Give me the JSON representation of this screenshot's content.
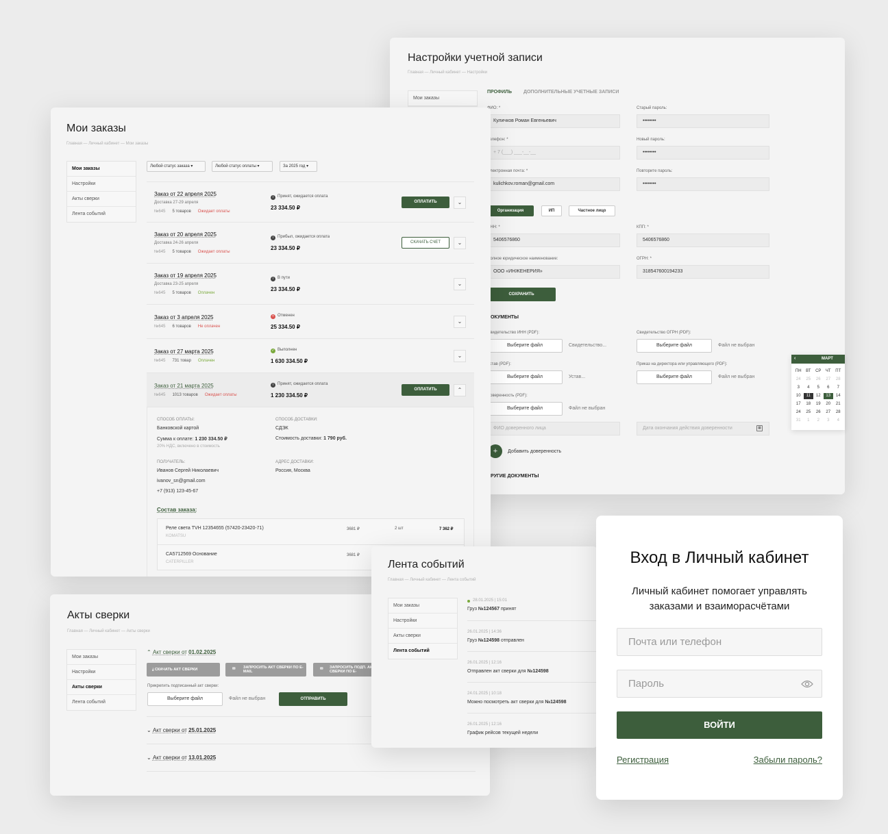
{
  "colors": {
    "accent": "#3d5e3c",
    "danger": "#d9534f",
    "success": "#7aa93c",
    "background": "#ececec"
  },
  "settings": {
    "title": "Настройки учетной записи",
    "breadcrumb": "Главная — Личный кабинет — Настройки",
    "sidebar": [
      "Мои заказы"
    ],
    "tabs": [
      "ПРОФИЛЬ",
      "ДОПОЛНИТЕЛЬНЫЕ УЧЕТНЫЕ ЗАПИСИ"
    ],
    "fio_label": "ФИО: *",
    "fio_value": "Куличков Роман Евгеньевич",
    "phone_label": "Телефон: *",
    "phone_placeholder": "+ 7 (___) ___-__-__",
    "email_label": "Электронная почта: *",
    "email_value": "kulichkov.roman@gmail.com",
    "old_pass_label": "Старый пароль:",
    "new_pass_label": "Новый пароль:",
    "repeat_pass_label": "Повторите пароль:",
    "pass_mask": "••••••••",
    "type_buttons": [
      "Организация",
      "ИП",
      "Частное лицо"
    ],
    "inn_label": "ИНН: *",
    "inn_value": "5406576860",
    "kpp_label": "КПП: *",
    "kpp_value": "5406576860",
    "fullname_label": "Полное юридическое наименование:",
    "fullname_value": "ООО «ИНЖЕНЕРИЯ»",
    "ogrn_label": "ОГРН: *",
    "ogrn_value": "318547600194233",
    "save_label": "СОХРАНИТЬ",
    "docs_heading": "ДОКУМЕНТЫ",
    "doc_inn_label": "Свидетельство ИНН (PDF):",
    "doc_inn_file": "Свидетельство...",
    "doc_ogrn_label": "Свидетельство ОГРН (PDF):",
    "doc_ogrn_file": "Файл не выбран",
    "doc_ustav_label": "Устав (PDF):",
    "doc_ustav_file": "Устав...",
    "doc_prikaz_label": "Приказ на директора или управляющего (PDF):",
    "doc_prikaz_file": "Файл не выбран",
    "doc_dov_label": "Доверенность (PDF):",
    "doc_dov_file": "Файл не выбран",
    "choose_file": "Выберите файл",
    "fio_dov_placeholder": "ФИО доверенного лица",
    "dov_end_placeholder": "Дата окончания действия доверенности",
    "add_dov": "Добавить доверенность",
    "other_docs": "ДРУГИЕ ДОКУМЕНТЫ"
  },
  "calendar": {
    "month": "МАРТ",
    "weekdays": [
      "ПН",
      "ВТ",
      "СР",
      "ЧТ",
      "ПТ"
    ],
    "days": [
      "24",
      "25",
      "26",
      "27",
      "28",
      "3",
      "4",
      "5",
      "6",
      "7",
      "10",
      "11",
      "12",
      "13",
      "14",
      "17",
      "18",
      "19",
      "20",
      "21",
      "24",
      "25",
      "26",
      "27",
      "28",
      "31",
      "1",
      "2",
      "3",
      "4"
    ],
    "selected": "11",
    "highlighted": "13"
  },
  "orders": {
    "title": "Мои заказы",
    "breadcrumb": "Главная — Личный кабинет — Мои заказы",
    "sidebar": [
      "Мои заказы",
      "Настройки",
      "Акты сверки",
      "Лента событий"
    ],
    "filters": [
      "Любой статус заказа",
      "Любой статус оплаты",
      "За 2025 год"
    ],
    "items": [
      {
        "title": "Заказ от 22 апреля 2025",
        "delivery": "Доставка 27-29 апреля",
        "num": "№645",
        "count": "5 товаров",
        "pay": "Ожидает оплаты",
        "status": "Принят, ожидается оплата",
        "sum": "23 334.50 ₽",
        "action": "ОПЛАТИТЬ"
      },
      {
        "title": "Заказ от 20 апреля 2025",
        "delivery": "Доставка 24-26 апреля",
        "num": "№645",
        "count": "5 товаров",
        "pay": "Ожидает оплаты",
        "status": "Прибыл, ожидается оплата",
        "sum": "23 334.50 ₽",
        "action": "СКАЧАТЬ СЧЕТ"
      },
      {
        "title": "Заказ от 19 апреля 2025",
        "delivery": "Доставка 23-25 апреля",
        "num": "№645",
        "count": "5 товаров",
        "pay": "Оплачен",
        "status": "В пути",
        "sum": "23 334.50 ₽"
      },
      {
        "title": "Заказ от 3 апреля 2025",
        "num": "№645",
        "count": "6 товаров",
        "pay": "Не оплачен",
        "status": "Отменен",
        "sum": "25 334.50 ₽"
      },
      {
        "title": "Заказ от 27 марта 2025",
        "num": "№645",
        "count": "731 товар",
        "pay": "Оплачен",
        "status": "Выполнен",
        "sum": "1 630 334.50 ₽"
      },
      {
        "title": "Заказ от 21 марта 2025",
        "num": "№645",
        "count": "1013 товаров",
        "pay": "Ожидает оплаты",
        "status": "Принят, ожидается оплата",
        "sum": "1 230 334.50 ₽",
        "action": "ОПЛАТИТЬ"
      }
    ],
    "detail": {
      "pay_method_label": "СПОСОБ ОПЛАТЫ:",
      "pay_method": "Банковской картой",
      "to_pay_label": "Сумма к оплате:",
      "to_pay": "1 230 334.50 ₽",
      "vat": "20% НДС, включено в стоимость",
      "delivery_method_label": "СПОСОБ ДОСТАВКИ:",
      "delivery_method": "СДЭК",
      "delivery_cost_label": "Стоимость доставки:",
      "delivery_cost": "1 790 руб.",
      "recipient_label": "ПОЛУЧАТЕЛЬ:",
      "recipient_name": "Иванов Сергей Николаевич",
      "recipient_email": "ivanov_sn@gmail.com",
      "recipient_phone": "+7 (913) 123-45-67",
      "address_label": "АДРЕС ДОСТАВКИ:",
      "address": "Россия, Москва",
      "composition": "Состав заказа:",
      "products": [
        {
          "name": "Реле света TVH 12354655 (57420-23420-71)",
          "brand": "KOMATSU",
          "price": "3681 ₽",
          "qty": "2 шт",
          "total": "7 362 ₽"
        },
        {
          "name": "CA5712569 Основание",
          "brand": "CATERPILLER",
          "price": "3681 ₽",
          "qty": "",
          "total": ""
        }
      ]
    }
  },
  "acts": {
    "title": "Акты сверки",
    "breadcrumb": "Главная — Личный кабинет — Акты сверки",
    "sidebar": [
      "Мои заказы",
      "Настройки",
      "Акты сверки",
      "Лента событий"
    ],
    "act1_prefix": "Акт сверки от",
    "act1_date": "01.02.2025",
    "download": "СКАЧАТЬ АКТ СВЕРКИ",
    "request_email": "ЗАПРОСИТЬ АКТ СВЕРКИ ПО E-MAIL",
    "request_signed": "ЗАПРОСИТЬ ПОДП. АКТ СВЕРКИ ПО E-",
    "attach_label": "Прикрепить подписанный акт сверки:",
    "choose_file": "Выберите файл",
    "no_file": "Файл не выбран",
    "send": "ОТПРАВИТЬ",
    "act2_date": "25.01.2025",
    "act3_date": "13.01.2025"
  },
  "events": {
    "title": "Лента событий",
    "breadcrumb": "Главная — Личный кабинет — Лента событий",
    "sidebar": [
      "Мои заказы",
      "Настройки",
      "Акты сверки",
      "Лента событий"
    ],
    "items": [
      {
        "date": "28.01.2025 | 15:01",
        "pre": "Груз ",
        "bold": "№124567",
        "post": " принят"
      },
      {
        "date": "26.01.2025 | 14:36",
        "pre": "Груз ",
        "bold": "№124598",
        "post": " отправлен"
      },
      {
        "date": "26.01.2025 | 12:16",
        "pre": "Отправлен акт сверки для ",
        "bold": "№124598",
        "post": ""
      },
      {
        "date": "24.01.2025 | 10:18",
        "pre": "Можно посмотреть акт сверки для ",
        "bold": "№124598",
        "post": ""
      },
      {
        "date": "26.01.2025 | 12:16",
        "pre": "График рейсов текущей недели",
        "bold": "",
        "post": ""
      }
    ]
  },
  "login": {
    "title": "Вход в Личный кабинет",
    "subtitle": "Личный кабинет помогает управлять заказами и взаиморасчётами",
    "login_placeholder": "Почта или телефон",
    "password_placeholder": "Пароль",
    "submit": "ВОЙТИ",
    "register": "Регистрация",
    "forgot": "Забыли пароль?"
  }
}
